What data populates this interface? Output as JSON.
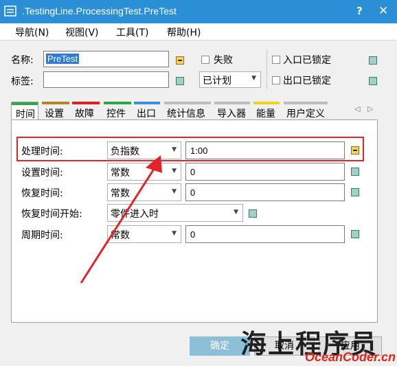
{
  "window": {
    "title": ".TestingLine.ProcessingTest.PreTest",
    "help": "?",
    "close": "✕"
  },
  "menu": [
    "导航(N)",
    "视图(V)",
    "工具(T)",
    "帮助(H)"
  ],
  "header": {
    "name_label": "名称:",
    "name_value": "PreTest",
    "tag_label": "标签:",
    "tag_value": "",
    "failed_label": "失败",
    "plan_value": "已计划",
    "entrance_locked_label": "入口已锁定",
    "exit_locked_label": "出口已锁定"
  },
  "tabs": [
    {
      "label": "时间",
      "color": "#2aa84a",
      "active": true
    },
    {
      "label": "设置",
      "color": "#b5832a"
    },
    {
      "label": "故障",
      "color": "#e02020"
    },
    {
      "label": "控件",
      "color": "#2aa84a"
    },
    {
      "label": "出口",
      "color": "#3c8fe0"
    },
    {
      "label": "统计信息",
      "color": "#bdbdbd"
    },
    {
      "label": "导入器",
      "color": "#bdbdbd"
    },
    {
      "label": "能量",
      "color": "#f0d020"
    },
    {
      "label": "用户定义",
      "color": "#bdbdbd"
    }
  ],
  "timing": {
    "rows": [
      {
        "label": "处理时间:",
        "dist": "负指数",
        "value": "1:00",
        "highlighted": true
      },
      {
        "label": "设置时间:",
        "dist": "常数",
        "value": "0"
      },
      {
        "label": "恢复时间:",
        "dist": "常数",
        "value": "0"
      },
      {
        "label": "恢复时间开始:",
        "dist": "零件进入时"
      },
      {
        "label": "周期时间:",
        "dist": "常数",
        "value": "0"
      }
    ]
  },
  "buttons": {
    "ok": "确定",
    "cancel": "取消",
    "apply": "应用"
  },
  "watermark": {
    "text": "海上程序员",
    "url": "OceanCoder.cn"
  },
  "colors": {
    "titlebar": "#2b8fd6",
    "highlight": "#e0242a",
    "selection": "#2e7bd4"
  }
}
